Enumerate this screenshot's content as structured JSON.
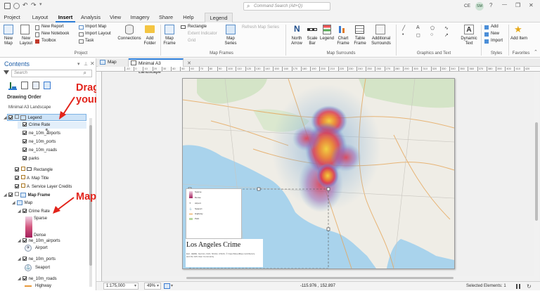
{
  "titlebar": {
    "search_placeholder": "Command Search (Alt+Q)",
    "user_initials": "CE",
    "avatar_initials": "SM",
    "help_glyph": "?",
    "minimize_glyph": "—",
    "maximize_glyph": "❐",
    "close_glyph": "✕"
  },
  "ribbon_tabs": [
    "Project",
    "Layout",
    "Insert",
    "Analysis",
    "View",
    "Imagery",
    "Share",
    "Help",
    "Legend"
  ],
  "ribbon": {
    "project": {
      "new_map": "New Map",
      "new_layout": "New Layout",
      "new_report": "New Report",
      "new_notebook": "New Notebook",
      "toolbox": "Toolbox",
      "import_map": "Import Map",
      "import_layout": "Import Layout",
      "task": "Task",
      "connections": "Connections",
      "add_folder": "Add Folder",
      "group_label": "Project"
    },
    "map_frames": {
      "map_frame": "Map Frame",
      "rectangle": "Rectangle",
      "extent_indicator": "Extent Indicator",
      "grid": "Grid",
      "map_series": "Map Series",
      "refresh_map_series": "Refresh Map Series",
      "group_label": "Map Frames"
    },
    "map_surrounds": {
      "north_arrow": "North Arrow",
      "scale_bar": "Scale Bar",
      "legend": "Legend",
      "chart_frame": "Chart Frame",
      "table_frame": "Table Frame",
      "additional_surrounds": "Additional Surrounds",
      "group_label": "Map Surrounds"
    },
    "graphics": {
      "dynamic_text": "Dynamic Text",
      "group_label": "Graphics and Text"
    },
    "styles": {
      "add": "Add",
      "new": "New",
      "import": "Import",
      "group_label": "Styles"
    },
    "favorites": {
      "add_item": "Add Item",
      "group_label": "Favorites"
    }
  },
  "contents": {
    "title": "Contents",
    "search_placeholder": "Search",
    "drawing_order_label": "Drawing Order",
    "root": "Minimal A3 Landscape",
    "items": [
      {
        "label": "Legend",
        "indent": 0,
        "selected": true
      },
      {
        "label": "Crime Rate",
        "indent": 1
      },
      {
        "label": "ne_10m_airports",
        "indent": 1
      },
      {
        "label": "ne_10m_ports",
        "indent": 1
      },
      {
        "label": "ne_10m_roads",
        "indent": 1
      },
      {
        "label": "parks",
        "indent": 1
      },
      {
        "label": "Rectangle",
        "indent": 0
      },
      {
        "label": "Map Title",
        "indent": 0
      },
      {
        "label": "Service Layer Credits",
        "indent": 0
      },
      {
        "label": "Map Frame",
        "indent": 0,
        "bold": true
      },
      {
        "label": "Map",
        "indent": 1
      },
      {
        "label": "Crime Rate",
        "indent": 2
      },
      {
        "label": "Sparse",
        "indent": 3
      },
      {
        "label": "Dense",
        "indent": 3
      },
      {
        "label": "ne_10m_airports",
        "indent": 2
      },
      {
        "label": "Airport",
        "indent": 3
      },
      {
        "label": "ne_10m_ports",
        "indent": 2
      },
      {
        "label": "Seaport",
        "indent": 3
      },
      {
        "label": "ne_10m_roads",
        "indent": 2
      },
      {
        "label": "Highway",
        "indent": 3
      }
    ]
  },
  "annotations": {
    "drag_drop": "Drag and Drop into your legend group",
    "drag_drop_line1": "Drag and Drop into",
    "drag_drop_line2": "your legend group",
    "map_items": "Map Items",
    "color": "#e2231a"
  },
  "view_tabs": [
    "Map",
    "Minimal A3 Landscape"
  ],
  "ruler_ticks": [
    "-10",
    "0",
    "10",
    "20",
    "30",
    "40",
    "50",
    "60",
    "70",
    "80",
    "90",
    "100",
    "110",
    "120",
    "130",
    "140",
    "150",
    "160",
    "170",
    "180",
    "190",
    "200",
    "210",
    "220",
    "230",
    "240",
    "250",
    "260",
    "270",
    "280",
    "290",
    "300",
    "310",
    "320",
    "330",
    "340",
    "350",
    "360",
    "370",
    "380",
    "390",
    "400",
    "410",
    "420",
    "430"
  ],
  "layout": {
    "map_title": "Los Angeles Crime",
    "legend_entries": [
      "Sparse",
      "Dense",
      "Airport",
      "Seaport",
      "Highway",
      "Park"
    ],
    "credits": "Esri, HERE, Garmin, FAO, NOAA, USGS, © OpenStreetMap contributors, and the GIS User Community"
  },
  "colors": {
    "accent": "#2a7bd6",
    "water": "#a9d3ec",
    "land": "#efede6",
    "heat_low": "#6aa8d8",
    "heat_mid": "#e8453c",
    "heat_high": "#f6d23a"
  },
  "statusbar": {
    "scale": "1:175,000",
    "zoom": "49%",
    "coordinates": "-115.976 , 152.897",
    "selected": "Selected Elements: 1"
  }
}
